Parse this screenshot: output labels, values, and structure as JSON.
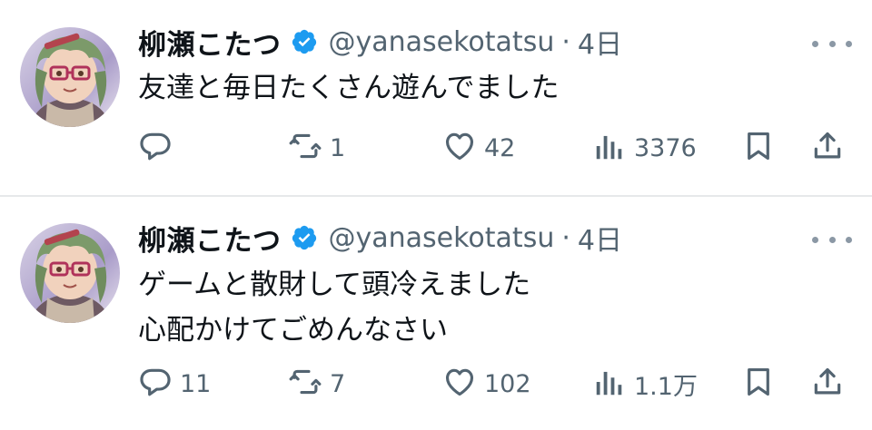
{
  "tweets": [
    {
      "display_name": "柳瀬こたつ",
      "handle": "@yanasekotatsu",
      "separator": "·",
      "time": "4日",
      "text_lines": [
        "友達と毎日たくさん遊んでました"
      ],
      "reply_count": "",
      "retweet_count": "1",
      "like_count": "42",
      "view_count": "3376"
    },
    {
      "display_name": "柳瀬こたつ",
      "handle": "@yanasekotatsu",
      "separator": "·",
      "time": "4日",
      "text_lines": [
        "ゲームと散財して頭冷えました",
        "心配かけてごめんなさい"
      ],
      "reply_count": "11",
      "retweet_count": "7",
      "like_count": "102",
      "view_count": "1.1万"
    }
  ],
  "colors": {
    "text": "#0f1419",
    "secondary": "#536471",
    "verified": "#1d9bf0",
    "divider": "#e6e8ea"
  },
  "icons": [
    "reply-icon",
    "retweet-icon",
    "like-icon",
    "views-icon",
    "bookmark-icon",
    "share-icon",
    "more-icon",
    "verified-icon"
  ]
}
